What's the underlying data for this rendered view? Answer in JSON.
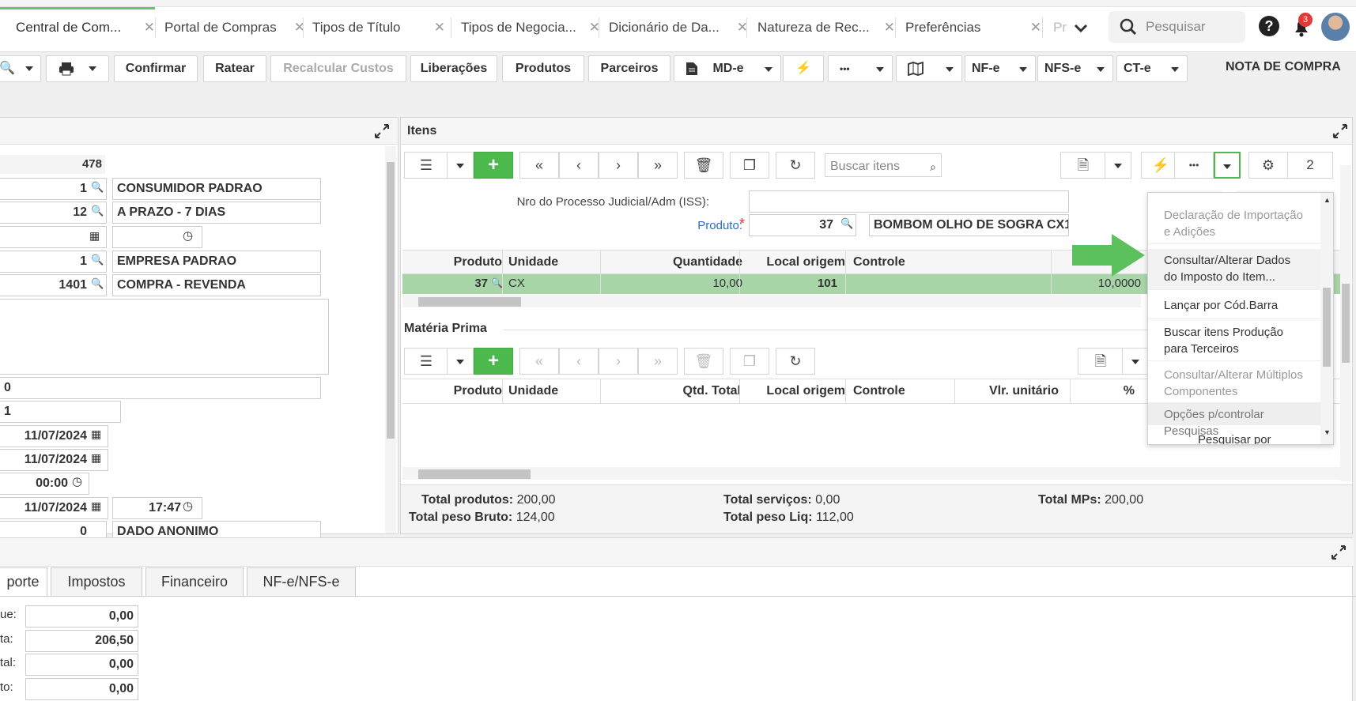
{
  "tabs": [
    {
      "label": "Central de Com...",
      "active": true
    },
    {
      "label": "Portal de Compras"
    },
    {
      "label": "Tipos de Título"
    },
    {
      "label": "Tipos de Negocia..."
    },
    {
      "label": "Dicionário de Da..."
    },
    {
      "label": "Natureza de Rec..."
    },
    {
      "label": "Preferências"
    },
    {
      "label": "Pr"
    }
  ],
  "search": {
    "placeholder": "Pesquisar"
  },
  "notifications": {
    "count": "3"
  },
  "toolbar": {
    "confirmar": "Confirmar",
    "ratear": "Ratear",
    "recalcular": "Recalcular Custos",
    "liberacoes": "Liberações",
    "produtos": "Produtos",
    "parceiros": "Parceiros",
    "mde": "MD-e",
    "more": "•••",
    "nfe": "NF-e",
    "nfse": "NFS-e",
    "cte": "CT-e",
    "title": "NOTA DE COMPRA"
  },
  "header_form": {
    "nro_unico": "478",
    "parceiro_cod": "1",
    "parceiro_nome": "CONSUMIDOR PADRAO",
    "tipo_neg_cod": "12",
    "tipo_neg_nome": "A PRAZO - 7 DIAS",
    "empresa_cod": "1",
    "empresa_nome": "EMPRESA PADRAO",
    "top_cod": "1401",
    "top_nome": "COMPRA - REVENDA",
    "field_0": "0",
    "field_1": "1",
    "date_1": "11/07/2024",
    "date_2": "11/07/2024",
    "time_1": "00:00",
    "date_3": "11/07/2024",
    "time_2": "17:47",
    "last_cod": "0",
    "last_nome": "DADO ANONIMO"
  },
  "itens": {
    "title": "Itens",
    "search_placeholder": "Buscar itens",
    "page_count": "2",
    "label_processo": "Nro do Processo Judicial/Adm (ISS):",
    "label_produto": "Produto:",
    "produto_cod": "37",
    "produto_nome": "BOMBOM OLHO DE SOGRA CX1",
    "columns": [
      "Produto",
      "Unidade",
      "Quantidade",
      "Local origem",
      "Controle"
    ],
    "row": {
      "produto": "37",
      "unidade": "CX",
      "quantidade": "10,00",
      "local": "101",
      "controle": "",
      "vlr": "10,0000"
    }
  },
  "materia": {
    "title": "Matéria Prima",
    "columns": [
      "Produto",
      "Unidade",
      "Qtd. Total",
      "Local origem",
      "Controle",
      "Vlr. unitário",
      "%"
    ]
  },
  "totais": {
    "produtos_label": "Total produtos:",
    "produtos": "200,00",
    "servicos_label": "Total serviços:",
    "servicos": "0,00",
    "mps_label": "Total MPs:",
    "mps": "200,00",
    "peso_bruto_label": "Total peso Bruto:",
    "peso_bruto": "124,00",
    "peso_liq_label": "Total peso Liq:",
    "peso_liq": "112,00"
  },
  "menu": {
    "items": [
      {
        "label": "Declaração de Importação e Adições",
        "state": "disabled"
      },
      {
        "label": "Consultar/Alterar Dados do Imposto do Item...",
        "state": "highlight"
      },
      {
        "label": "Lançar por Cód.Barra",
        "state": "normal"
      },
      {
        "label": "Buscar itens Produção para Terceiros",
        "state": "normal"
      },
      {
        "label": "Consultar/Alterar Múltiplos Componentes",
        "state": "disabled"
      },
      {
        "label": "Opções p/controlar Pesquisas",
        "state": "section"
      },
      {
        "label": "Pesquisar por Cód.Barra",
        "state": "normal"
      }
    ]
  },
  "bottom_tabs": [
    "porte",
    "Impostos",
    "Financeiro",
    "NF-e/NFS-e"
  ],
  "bottom_fields": [
    {
      "label": "ue:",
      "value": "0,00"
    },
    {
      "label": "ta:",
      "value": "206,50"
    },
    {
      "label": "tal:",
      "value": "0,00"
    },
    {
      "label": "to:",
      "value": "0,00"
    }
  ],
  "colors": {
    "accent_green": "#4cb94c",
    "arrow_green": "#5cc05c",
    "row_green": "#a8d5a8",
    "link_blue": "#2a6bd1",
    "badge_red": "#e53935"
  }
}
